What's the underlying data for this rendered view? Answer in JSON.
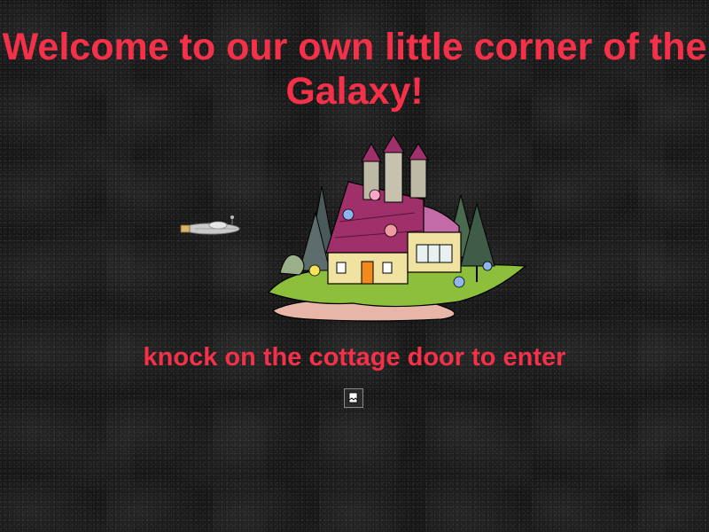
{
  "page": {
    "heading": "Welcome to our own little corner of the Galaxy!",
    "cta_text": "knock on the cottage door to enter"
  },
  "images": {
    "spaceship": "spaceship-illustration",
    "cottage": "cottage-illustration",
    "door_link": "broken-image-icon"
  },
  "colors": {
    "background": "#151515",
    "headline": "#f5314a",
    "roof": "#a0306a",
    "dome": "#c36aa8",
    "wall": "#f0e2a0",
    "door": "#f28a1e",
    "grass": "#8dbf3c",
    "path": "#e7b6a8"
  }
}
